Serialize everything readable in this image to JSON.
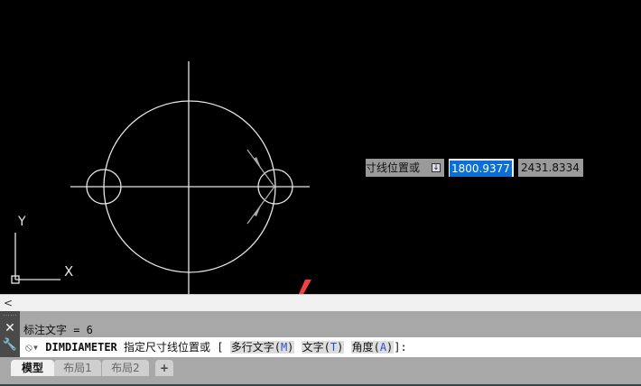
{
  "dynamic_input": {
    "prompt": "寸线位置或",
    "x_value": "1800.9377",
    "y_value": "2431.8334"
  },
  "ucs": {
    "x_label": "X",
    "y_label": "Y"
  },
  "scroll": {
    "left_arrow": "<"
  },
  "command": {
    "history": "标注文字 = 6",
    "name": "DIMDIAMETER",
    "text": "指定尺寸线位置或 [",
    "options": [
      {
        "label": "多行文字(",
        "key": "M",
        "close": ")"
      },
      {
        "label": "文字(",
        "key": "T",
        "close": ")"
      },
      {
        "label": "角度(",
        "key": "A",
        "close": ")"
      }
    ],
    "suffix": "]:"
  },
  "tabs": [
    {
      "label": "模型"
    },
    {
      "label": "布局1"
    },
    {
      "label": "布局2"
    },
    {
      "label": "+"
    }
  ],
  "colors": {
    "annotation_arrow": "#f04040",
    "selection": "#0a6fd6"
  }
}
